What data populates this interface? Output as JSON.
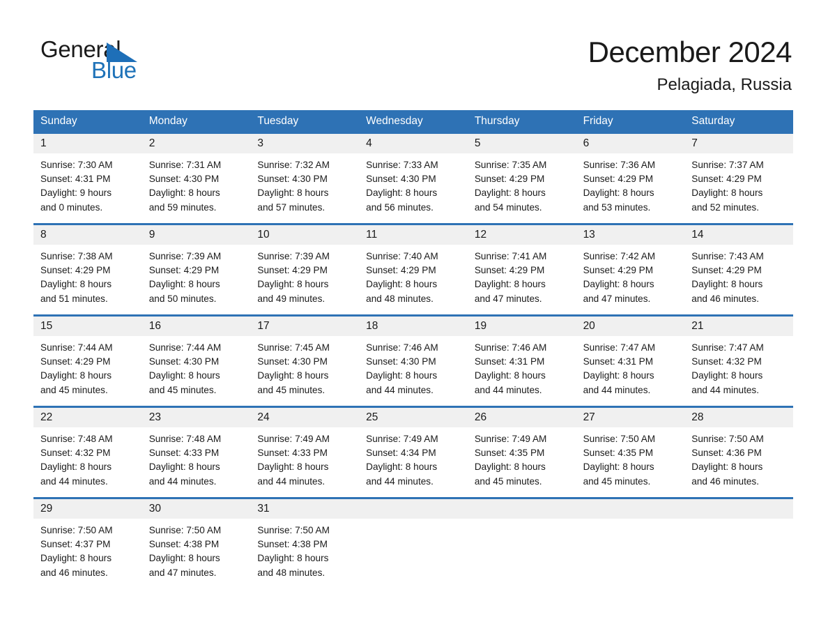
{
  "brand": {
    "name_part1": "General",
    "name_part2": "Blue",
    "triangle_icon": "triangle-icon",
    "accent_color": "#1E72B8"
  },
  "header": {
    "month_title": "December 2024",
    "location": "Pelagiada, Russia",
    "header_bg_color": "#2E72B5",
    "daynum_bg_color": "#F0F0F0"
  },
  "weekdays": [
    "Sunday",
    "Monday",
    "Tuesday",
    "Wednesday",
    "Thursday",
    "Friday",
    "Saturday"
  ],
  "weeks": [
    {
      "days": [
        {
          "date": "1",
          "sunrise": "Sunrise: 7:30 AM",
          "sunset": "Sunset: 4:31 PM",
          "daylight_line1": "Daylight: 9 hours",
          "daylight_line2": "and 0 minutes."
        },
        {
          "date": "2",
          "sunrise": "Sunrise: 7:31 AM",
          "sunset": "Sunset: 4:30 PM",
          "daylight_line1": "Daylight: 8 hours",
          "daylight_line2": "and 59 minutes."
        },
        {
          "date": "3",
          "sunrise": "Sunrise: 7:32 AM",
          "sunset": "Sunset: 4:30 PM",
          "daylight_line1": "Daylight: 8 hours",
          "daylight_line2": "and 57 minutes."
        },
        {
          "date": "4",
          "sunrise": "Sunrise: 7:33 AM",
          "sunset": "Sunset: 4:30 PM",
          "daylight_line1": "Daylight: 8 hours",
          "daylight_line2": "and 56 minutes."
        },
        {
          "date": "5",
          "sunrise": "Sunrise: 7:35 AM",
          "sunset": "Sunset: 4:29 PM",
          "daylight_line1": "Daylight: 8 hours",
          "daylight_line2": "and 54 minutes."
        },
        {
          "date": "6",
          "sunrise": "Sunrise: 7:36 AM",
          "sunset": "Sunset: 4:29 PM",
          "daylight_line1": "Daylight: 8 hours",
          "daylight_line2": "and 53 minutes."
        },
        {
          "date": "7",
          "sunrise": "Sunrise: 7:37 AM",
          "sunset": "Sunset: 4:29 PM",
          "daylight_line1": "Daylight: 8 hours",
          "daylight_line2": "and 52 minutes."
        }
      ]
    },
    {
      "days": [
        {
          "date": "8",
          "sunrise": "Sunrise: 7:38 AM",
          "sunset": "Sunset: 4:29 PM",
          "daylight_line1": "Daylight: 8 hours",
          "daylight_line2": "and 51 minutes."
        },
        {
          "date": "9",
          "sunrise": "Sunrise: 7:39 AM",
          "sunset": "Sunset: 4:29 PM",
          "daylight_line1": "Daylight: 8 hours",
          "daylight_line2": "and 50 minutes."
        },
        {
          "date": "10",
          "sunrise": "Sunrise: 7:39 AM",
          "sunset": "Sunset: 4:29 PM",
          "daylight_line1": "Daylight: 8 hours",
          "daylight_line2": "and 49 minutes."
        },
        {
          "date": "11",
          "sunrise": "Sunrise: 7:40 AM",
          "sunset": "Sunset: 4:29 PM",
          "daylight_line1": "Daylight: 8 hours",
          "daylight_line2": "and 48 minutes."
        },
        {
          "date": "12",
          "sunrise": "Sunrise: 7:41 AM",
          "sunset": "Sunset: 4:29 PM",
          "daylight_line1": "Daylight: 8 hours",
          "daylight_line2": "and 47 minutes."
        },
        {
          "date": "13",
          "sunrise": "Sunrise: 7:42 AM",
          "sunset": "Sunset: 4:29 PM",
          "daylight_line1": "Daylight: 8 hours",
          "daylight_line2": "and 47 minutes."
        },
        {
          "date": "14",
          "sunrise": "Sunrise: 7:43 AM",
          "sunset": "Sunset: 4:29 PM",
          "daylight_line1": "Daylight: 8 hours",
          "daylight_line2": "and 46 minutes."
        }
      ]
    },
    {
      "days": [
        {
          "date": "15",
          "sunrise": "Sunrise: 7:44 AM",
          "sunset": "Sunset: 4:29 PM",
          "daylight_line1": "Daylight: 8 hours",
          "daylight_line2": "and 45 minutes."
        },
        {
          "date": "16",
          "sunrise": "Sunrise: 7:44 AM",
          "sunset": "Sunset: 4:30 PM",
          "daylight_line1": "Daylight: 8 hours",
          "daylight_line2": "and 45 minutes."
        },
        {
          "date": "17",
          "sunrise": "Sunrise: 7:45 AM",
          "sunset": "Sunset: 4:30 PM",
          "daylight_line1": "Daylight: 8 hours",
          "daylight_line2": "and 45 minutes."
        },
        {
          "date": "18",
          "sunrise": "Sunrise: 7:46 AM",
          "sunset": "Sunset: 4:30 PM",
          "daylight_line1": "Daylight: 8 hours",
          "daylight_line2": "and 44 minutes."
        },
        {
          "date": "19",
          "sunrise": "Sunrise: 7:46 AM",
          "sunset": "Sunset: 4:31 PM",
          "daylight_line1": "Daylight: 8 hours",
          "daylight_line2": "and 44 minutes."
        },
        {
          "date": "20",
          "sunrise": "Sunrise: 7:47 AM",
          "sunset": "Sunset: 4:31 PM",
          "daylight_line1": "Daylight: 8 hours",
          "daylight_line2": "and 44 minutes."
        },
        {
          "date": "21",
          "sunrise": "Sunrise: 7:47 AM",
          "sunset": "Sunset: 4:32 PM",
          "daylight_line1": "Daylight: 8 hours",
          "daylight_line2": "and 44 minutes."
        }
      ]
    },
    {
      "days": [
        {
          "date": "22",
          "sunrise": "Sunrise: 7:48 AM",
          "sunset": "Sunset: 4:32 PM",
          "daylight_line1": "Daylight: 8 hours",
          "daylight_line2": "and 44 minutes."
        },
        {
          "date": "23",
          "sunrise": "Sunrise: 7:48 AM",
          "sunset": "Sunset: 4:33 PM",
          "daylight_line1": "Daylight: 8 hours",
          "daylight_line2": "and 44 minutes."
        },
        {
          "date": "24",
          "sunrise": "Sunrise: 7:49 AM",
          "sunset": "Sunset: 4:33 PM",
          "daylight_line1": "Daylight: 8 hours",
          "daylight_line2": "and 44 minutes."
        },
        {
          "date": "25",
          "sunrise": "Sunrise: 7:49 AM",
          "sunset": "Sunset: 4:34 PM",
          "daylight_line1": "Daylight: 8 hours",
          "daylight_line2": "and 44 minutes."
        },
        {
          "date": "26",
          "sunrise": "Sunrise: 7:49 AM",
          "sunset": "Sunset: 4:35 PM",
          "daylight_line1": "Daylight: 8 hours",
          "daylight_line2": "and 45 minutes."
        },
        {
          "date": "27",
          "sunrise": "Sunrise: 7:50 AM",
          "sunset": "Sunset: 4:35 PM",
          "daylight_line1": "Daylight: 8 hours",
          "daylight_line2": "and 45 minutes."
        },
        {
          "date": "28",
          "sunrise": "Sunrise: 7:50 AM",
          "sunset": "Sunset: 4:36 PM",
          "daylight_line1": "Daylight: 8 hours",
          "daylight_line2": "and 46 minutes."
        }
      ]
    },
    {
      "days": [
        {
          "date": "29",
          "sunrise": "Sunrise: 7:50 AM",
          "sunset": "Sunset: 4:37 PM",
          "daylight_line1": "Daylight: 8 hours",
          "daylight_line2": "and 46 minutes."
        },
        {
          "date": "30",
          "sunrise": "Sunrise: 7:50 AM",
          "sunset": "Sunset: 4:38 PM",
          "daylight_line1": "Daylight: 8 hours",
          "daylight_line2": "and 47 minutes."
        },
        {
          "date": "31",
          "sunrise": "Sunrise: 7:50 AM",
          "sunset": "Sunset: 4:38 PM",
          "daylight_line1": "Daylight: 8 hours",
          "daylight_line2": "and 48 minutes."
        },
        {
          "date": "",
          "sunrise": "",
          "sunset": "",
          "daylight_line1": "",
          "daylight_line2": ""
        },
        {
          "date": "",
          "sunrise": "",
          "sunset": "",
          "daylight_line1": "",
          "daylight_line2": ""
        },
        {
          "date": "",
          "sunrise": "",
          "sunset": "",
          "daylight_line1": "",
          "daylight_line2": ""
        },
        {
          "date": "",
          "sunrise": "",
          "sunset": "",
          "daylight_line1": "",
          "daylight_line2": ""
        }
      ]
    }
  ]
}
